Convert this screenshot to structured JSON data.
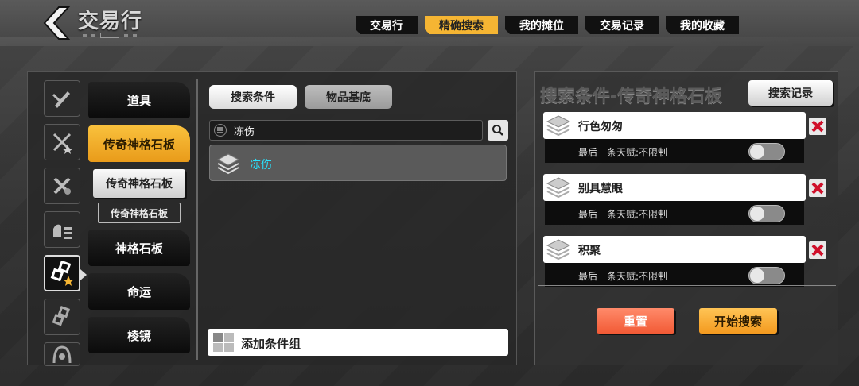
{
  "header": {
    "title": "交易行",
    "back_icon": "chevron-left-icon",
    "tabs": [
      {
        "label": "交易行",
        "active": false
      },
      {
        "label": "精确搜索",
        "active": true
      },
      {
        "label": "我的摊位",
        "active": false
      },
      {
        "label": "交易记录",
        "active": false
      },
      {
        "label": "我的收藏",
        "active": false
      }
    ]
  },
  "categories": {
    "icons": [
      "slash-icon",
      "crossed-star-icon",
      "crossed-tools-icon",
      "hand-list-icon",
      "link-star-icon",
      "link-icon",
      "helmet-icon"
    ],
    "items": [
      {
        "label": "道具"
      },
      {
        "label": "传奇神格石板"
      },
      {
        "label": "神格石板"
      },
      {
        "label": "命运"
      },
      {
        "label": "棱镜"
      }
    ],
    "sub_label": "传奇神格石板",
    "sub_sub_label": "传奇神格石板"
  },
  "search": {
    "tab_conditions": "搜索条件",
    "tab_base": "物品基底",
    "input_value": "冻伤",
    "results": [
      {
        "label": "冻伤"
      }
    ],
    "add_group_label": "添加条件组"
  },
  "conditions_panel": {
    "title": "搜索条件-传奇神格石板",
    "history_label": "搜索记录",
    "conditions": [
      {
        "name": "行色匆匆",
        "detail": "最后一条天赋:不限制",
        "enabled": false
      },
      {
        "name": "别具慧眼",
        "detail": "最后一条天赋:不限制",
        "enabled": false
      },
      {
        "name": "积聚",
        "detail": "最后一条天赋:不限制",
        "enabled": false
      }
    ],
    "reset_label": "重置",
    "start_label": "开始搜索"
  },
  "colors": {
    "accent": "#f5b533",
    "result_text": "#29e4ff",
    "delete": "#d0102a",
    "reset": "#f25a35",
    "start": "#f39a1f"
  }
}
